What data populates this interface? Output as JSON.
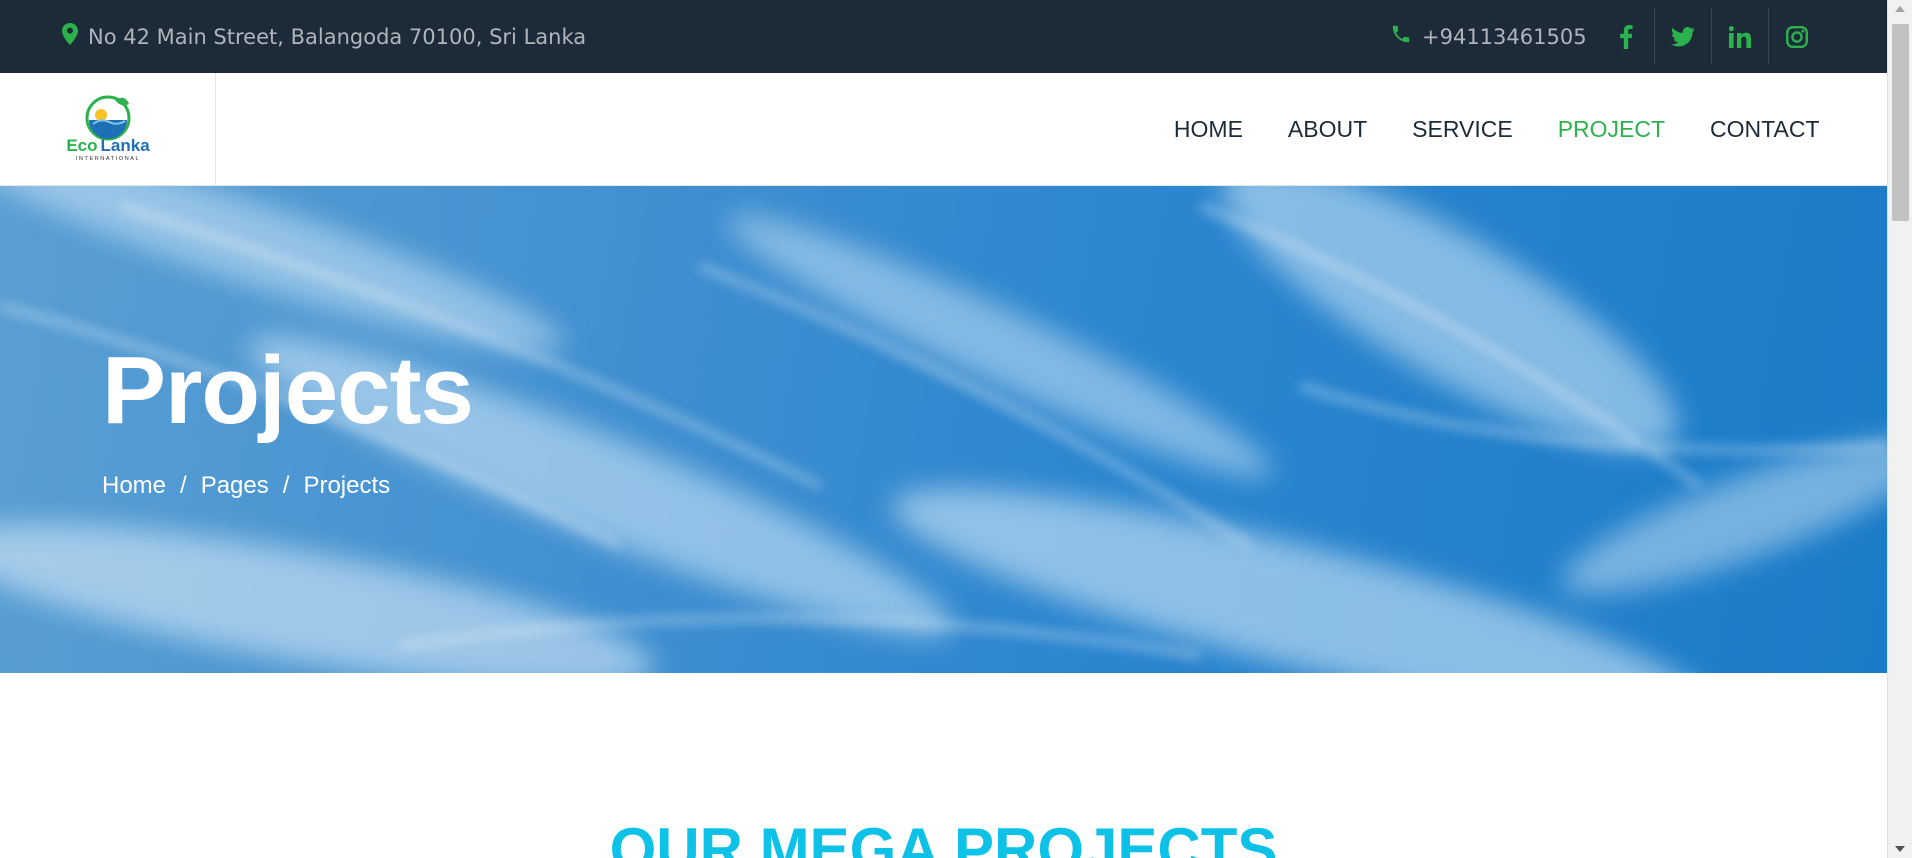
{
  "topbar": {
    "address": "No 42 Main Street, Balangoda 70100, Sri Lanka",
    "phone": "+94113461505",
    "social": [
      "facebook-icon",
      "twitter-icon",
      "linkedin-icon",
      "instagram-icon"
    ]
  },
  "logo": {
    "brand_eco": "Eco",
    "brand_lanka": "Lanka",
    "brand_sub": "INTERNATIONAL"
  },
  "nav": {
    "items": [
      {
        "label": "HOME",
        "active": false
      },
      {
        "label": "ABOUT",
        "active": false
      },
      {
        "label": "SERVICE",
        "active": false
      },
      {
        "label": "PROJECT",
        "active": true
      },
      {
        "label": "CONTACT",
        "active": false
      }
    ]
  },
  "hero": {
    "title": "Projects",
    "breadcrumb": [
      {
        "label": "Home"
      },
      {
        "label": "Pages"
      },
      {
        "label": "Projects"
      }
    ],
    "separator": "/"
  },
  "section": {
    "heading": "OUR MEGA PROJECTS"
  },
  "colors": {
    "topbar_bg": "#1d2a38",
    "accent_green": "#2bb24c",
    "heading_cyan": "#0ec1e6",
    "nav_text": "#1d2a38"
  }
}
